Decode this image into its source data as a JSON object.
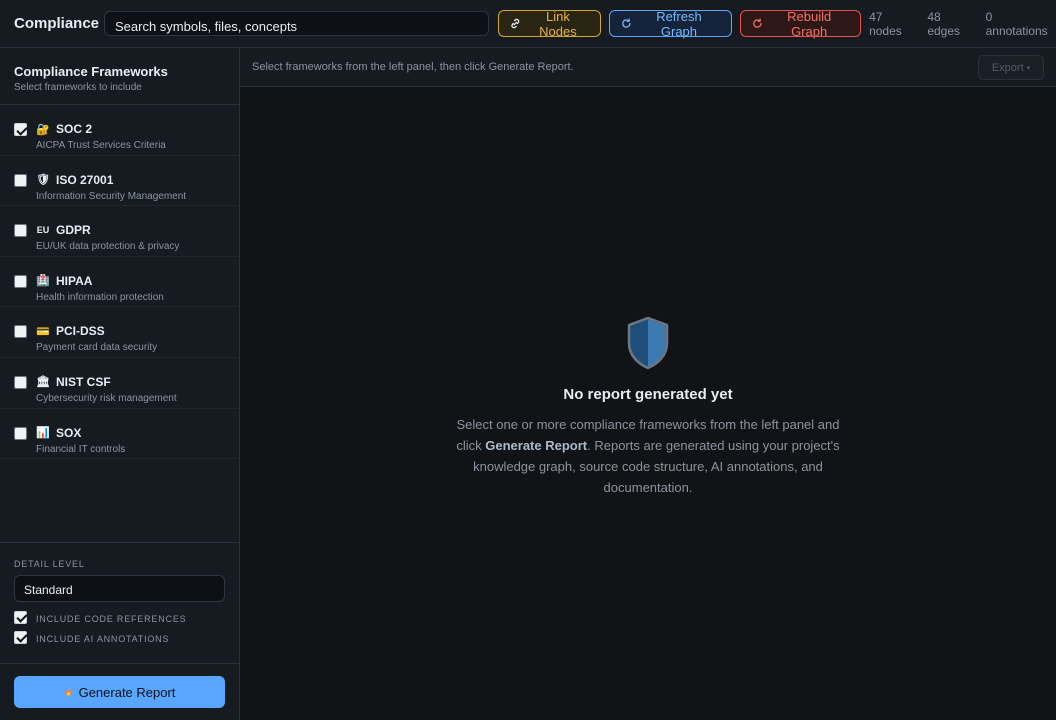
{
  "app": {
    "title": "Compliance"
  },
  "toolbar": {
    "search_placeholder": "Search symbols, files, concepts",
    "link_label": "Link Nodes",
    "refresh_label": "Refresh Graph",
    "rebuild_label": "Rebuild Graph",
    "nodes": "47 nodes",
    "edges": "48 edges",
    "annotations": "0 annotations",
    "colors": {
      "link": "#e3b341",
      "refresh": "#79b8ff",
      "rebuild": "#f47067"
    }
  },
  "sidebar": {
    "title": "Compliance Frameworks",
    "subtitle": "Select frameworks to include",
    "frameworks": [
      {
        "emoji": "🔐",
        "name": "SOC 2",
        "desc": "AICPA Trust Services Criteria",
        "checked": true
      },
      {
        "emoji": "🛡",
        "name": "ISO 27001",
        "desc": "Information Security Management",
        "checked": false
      },
      {
        "emoji": "EU",
        "name": "GDPR",
        "desc": "EU/UK data protection & privacy",
        "checked": false
      },
      {
        "emoji": "🏥",
        "name": "HIPAA",
        "desc": "Health information protection",
        "checked": false
      },
      {
        "emoji": "💳",
        "name": "PCI-DSS",
        "desc": "Payment card data security",
        "checked": false
      },
      {
        "emoji": "🏛",
        "name": "NIST CSF",
        "desc": "Cybersecurity risk management",
        "checked": false
      },
      {
        "emoji": "📊",
        "name": "SOX",
        "desc": "Financial IT controls",
        "checked": false
      }
    ],
    "detail_label": "DETAIL LEVEL",
    "detail_value": "Standard",
    "opt_code_refs": "INCLUDE CODE REFERENCES",
    "opt_ai_annotations": "INCLUDE AI ANNOTATIONS",
    "generate_label": "Generate Report"
  },
  "main": {
    "hint": "Select frameworks from the left panel, then click Generate Report.",
    "export_label": "Export",
    "empty_title": "No report generated yet",
    "empty_text_1": "Select one or more compliance frameworks from the left panel and click ",
    "empty_text_bold": "Generate Report",
    "empty_text_2": ". Reports are generated using your project's knowledge graph, source code structure, AI annotations, and documentation."
  }
}
